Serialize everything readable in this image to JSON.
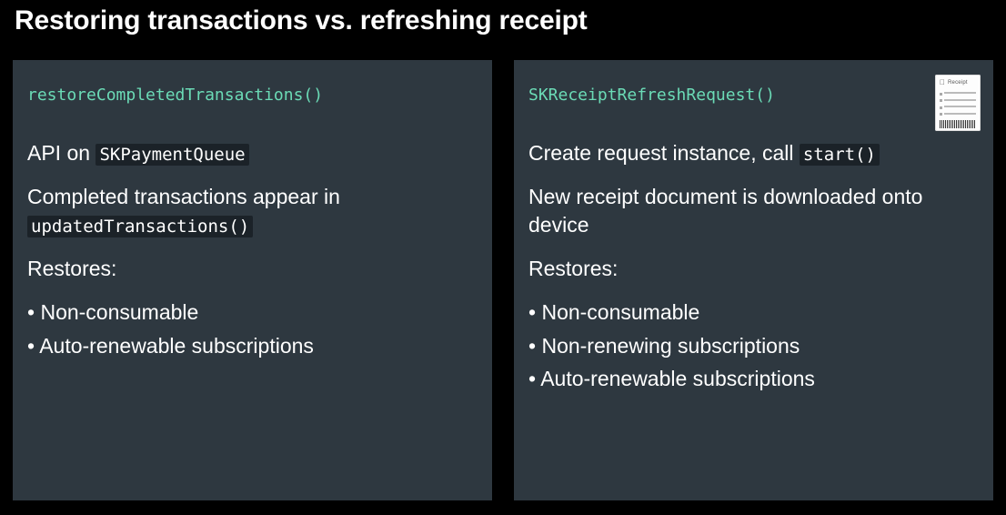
{
  "title": "Restoring transactions vs. refreshing receipt",
  "left": {
    "api": "restoreCompletedTransactions()",
    "line1_prefix": "API on ",
    "line1_code": "SKPaymentQueue",
    "line2_prefix": "Completed transactions appear in ",
    "line2_code": "updatedTransactions()",
    "restores_label": "Restores:",
    "restores": [
      "Non-consumable",
      "Auto-renewable subscriptions"
    ]
  },
  "right": {
    "api": "SKReceiptRefreshRequest()",
    "receipt_label": "Receipt",
    "line1_prefix": "Create request instance, call ",
    "line1_code": "start()",
    "line2": "New receipt document is downloaded onto device",
    "restores_label": "Restores:",
    "restores": [
      "Non-consumable",
      "Non-renewing subscriptions",
      "Auto-renewable subscriptions"
    ]
  }
}
